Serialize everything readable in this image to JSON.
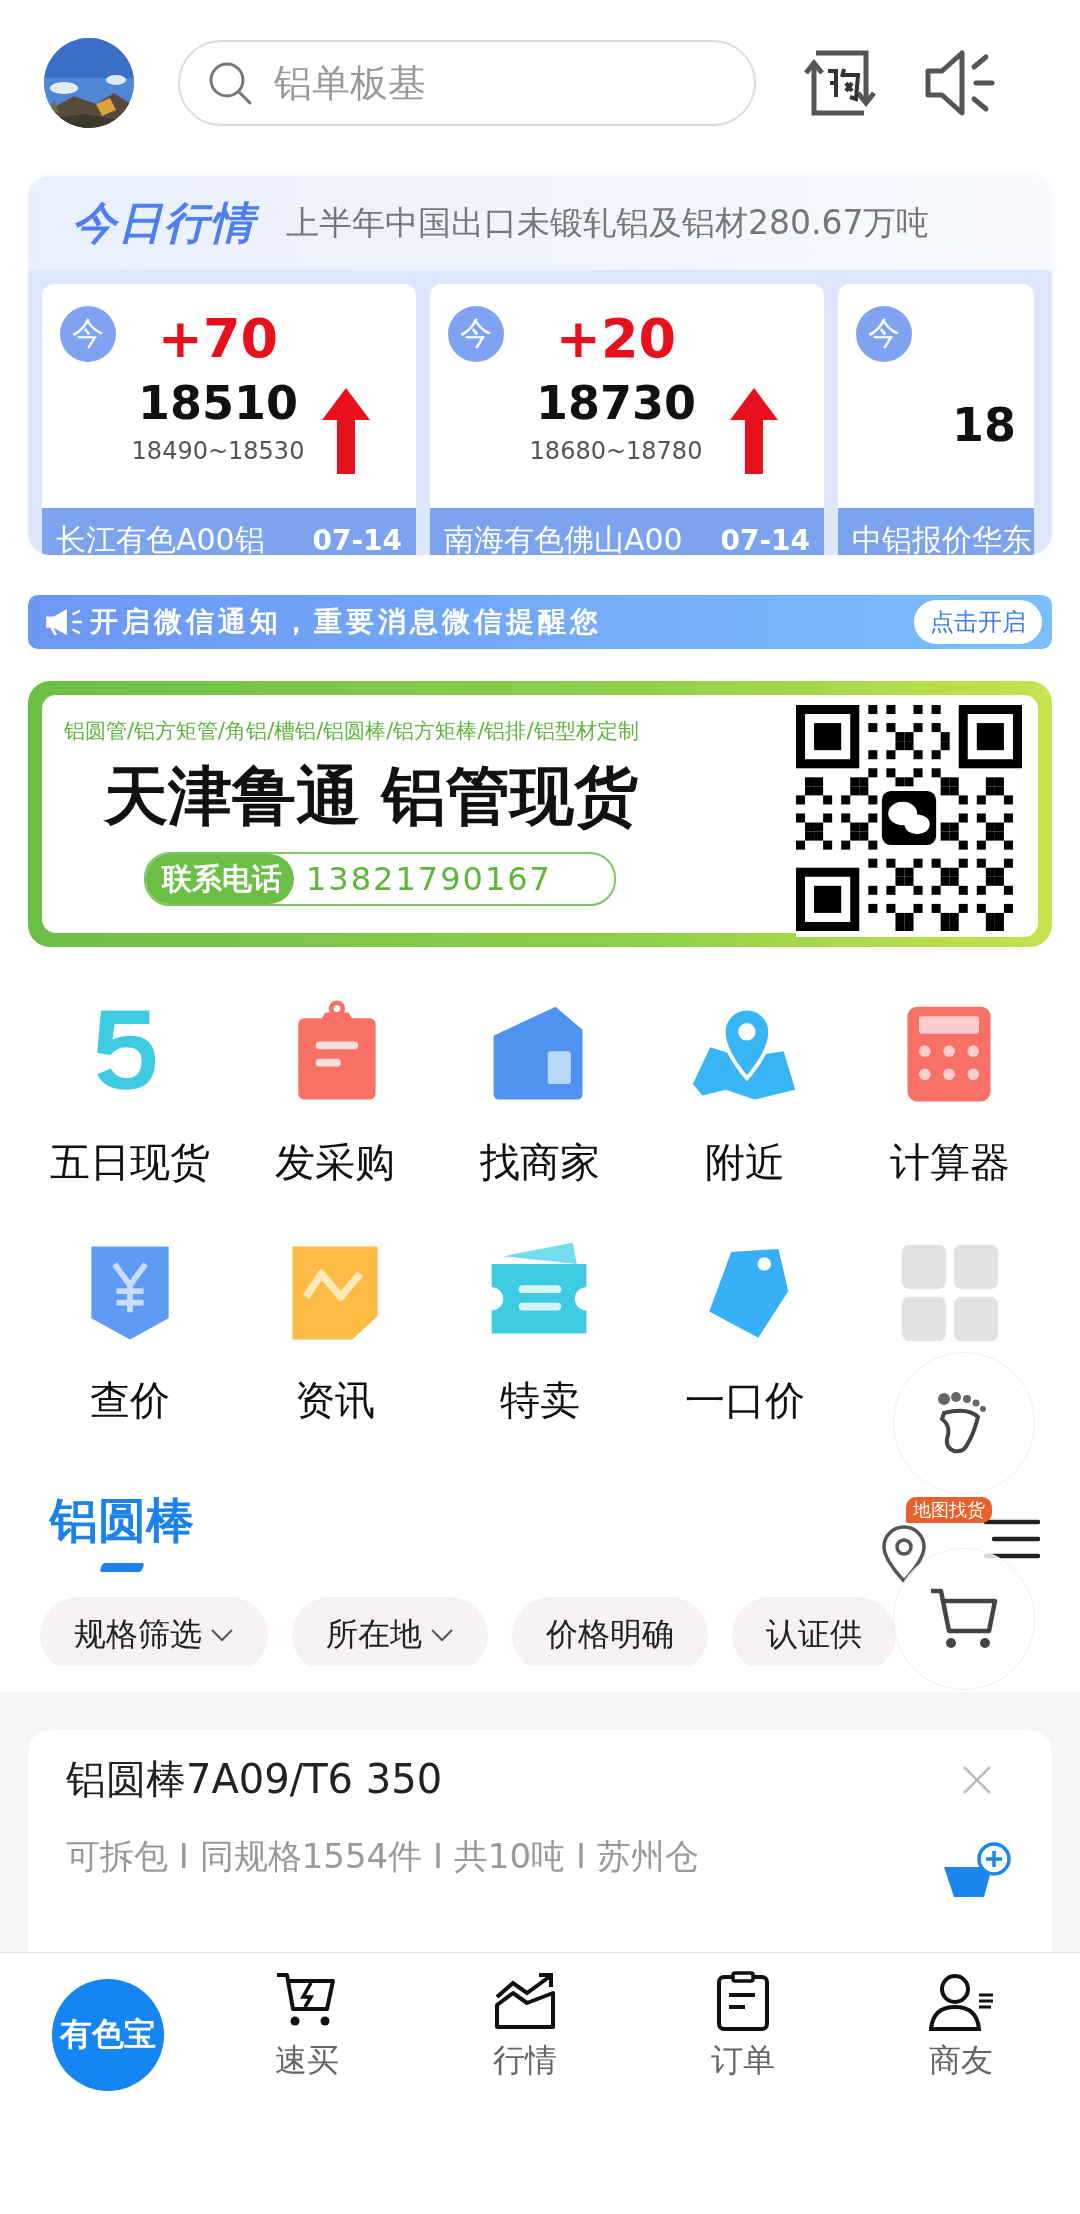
{
  "header": {
    "search": {
      "placeholder": "铝单板基"
    }
  },
  "market": {
    "title": "今日行情",
    "headline": "上半年中国出口未锻轧铝及铝材280.67万吨",
    "quotes": [
      {
        "badge": "今",
        "change": "+70",
        "price": "18510",
        "range": "18490~18530",
        "name": "长江有色A00铝",
        "date": "07-14",
        "rising": true
      },
      {
        "badge": "今",
        "change": "+20",
        "price": "18730",
        "range": "18680~18780",
        "name": "南海有色佛山A00",
        "date": "07-14",
        "rising": true
      },
      {
        "badge": "今",
        "price": "18",
        "name": "中铝报价华东"
      }
    ]
  },
  "notice": {
    "text": "开启微信通知，重要消息微信提醒您",
    "button": "点击开启"
  },
  "ad": {
    "tagline": "铝圆管/铝方矩管/角铝/槽铝/铝圆棒/铝方矩棒/铝排/铝型材定制",
    "headline": "天津鲁通 铝管现货",
    "phone_label": "联系电话",
    "phone": "13821790167"
  },
  "shortcuts": [
    {
      "kind": "app",
      "label": "五日现货"
    },
    {
      "kind": "app",
      "label": "发采购"
    },
    {
      "kind": "app",
      "label": "找商家"
    },
    {
      "kind": "app",
      "label": "附近"
    },
    {
      "kind": "app",
      "label": "计算器"
    },
    {
      "kind": "app",
      "label": "查价"
    },
    {
      "kind": "app",
      "label": "资讯"
    },
    {
      "kind": "app",
      "label": "特卖"
    },
    {
      "kind": "app",
      "label": "一口价"
    },
    {
      "kind": "more"
    }
  ],
  "section": {
    "title": "铝圆棒",
    "map_badge": "地图找货"
  },
  "filters": [
    {
      "label": "规格筛选",
      "dropdown": true
    },
    {
      "label": "所在地",
      "dropdown": true
    },
    {
      "label": "价格明确",
      "dropdown": false
    },
    {
      "label": "认证供",
      "dropdown": false
    }
  ],
  "listing": {
    "title": "铝圆棒7A09/T6 350",
    "details": "可拆包 I 同规格1554件 I 共10吨 I 苏州仓"
  },
  "nav": {
    "logo": "有色宝",
    "items": [
      {
        "label": "速买"
      },
      {
        "label": "行情"
      },
      {
        "label": "订单"
      },
      {
        "label": "商友"
      }
    ]
  }
}
